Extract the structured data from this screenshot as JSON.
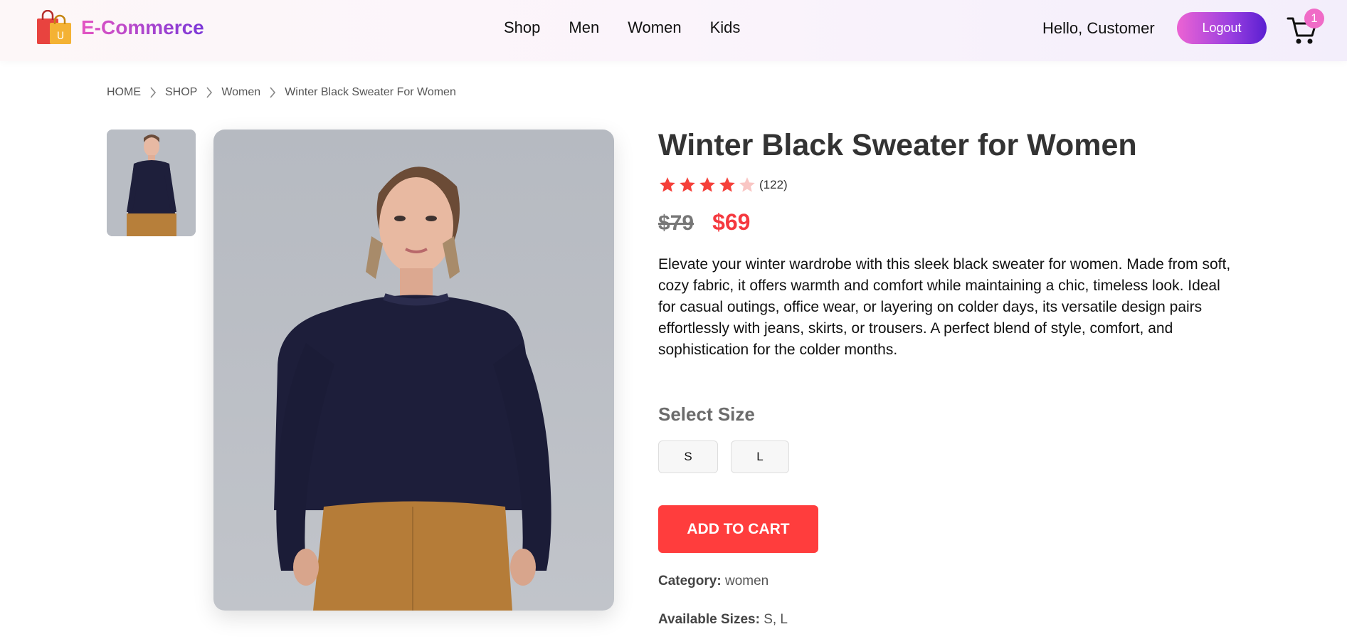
{
  "header": {
    "logo_text": "E-Commerce",
    "logo_bag_letter": "U",
    "nav": [
      "Shop",
      "Men",
      "Women",
      "Kids"
    ],
    "greeting": "Hello, Customer",
    "logout_label": "Logout",
    "cart_count": "1"
  },
  "breadcrumb": [
    "HOME",
    "SHOP",
    "Women",
    "Winter Black Sweater For Women"
  ],
  "product": {
    "title": "Winter Black Sweater for Women",
    "rating": 4,
    "rating_max": 5,
    "review_count": "(122)",
    "old_price": "$79",
    "new_price": "$69",
    "description": "Elevate your winter wardrobe with this sleek black sweater for women. Made from soft, cozy fabric, it offers warmth and comfort while maintaining a chic, timeless look. Ideal for casual outings, office wear, or layering on colder days, its versatile design pairs effortlessly with jeans, skirts, or trousers. A perfect blend of style, comfort, and sophistication for the colder months.",
    "select_size_label": "Select Size",
    "sizes": [
      "S",
      "L"
    ],
    "add_to_cart_label": "ADD TO CART",
    "category_label": "Category:",
    "category_value": "women",
    "available_sizes_label": "Available Sizes:",
    "available_sizes_value": "S, L"
  },
  "colors": {
    "accent_red": "#ff3d3d",
    "price_red": "#f5393f",
    "star_filled": "#f5403a",
    "star_empty": "#f9c6c4",
    "logo_gradient_start": "#e455c2",
    "logo_gradient_end": "#7a37d8",
    "cart_badge": "#f06bc7"
  },
  "icons": {
    "logo": "shopping-bags-icon",
    "cart": "shopping-cart-icon",
    "breadcrumb_separator": "chevron-right-icon",
    "rating": "star-icon"
  }
}
